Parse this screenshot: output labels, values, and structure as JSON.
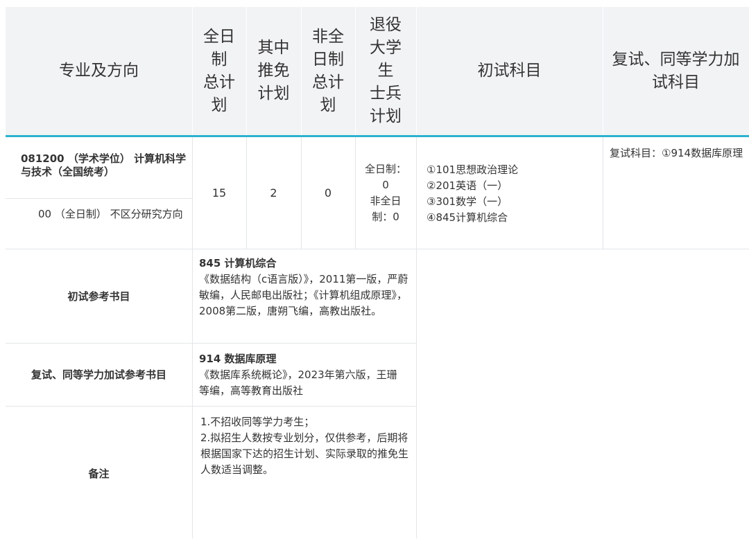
{
  "header": {
    "major": "专业及方向",
    "fulltime_plan": [
      "全日",
      "制",
      "总计",
      "划"
    ],
    "exempt_plan": [
      "其中",
      "推免",
      "计划"
    ],
    "parttime_plan": [
      "非全",
      "日制",
      "总计",
      "划"
    ],
    "veteran_plan": [
      "退役",
      "大学",
      "生",
      "士兵",
      "计划"
    ],
    "initial_subjects": "初试科目",
    "retest_subjects": [
      "复试、同等学力加",
      "试科目"
    ]
  },
  "major": {
    "name": "081200 （学术学位） 计算机科学与技术（全国统考）",
    "direction": "00 （全日制） 不区分研究方向",
    "fulltime_total": "15",
    "exempt": "2",
    "parttime_total": "0",
    "veteran": [
      "全日制：",
      "0",
      "非全日",
      "制：0"
    ],
    "initial_subjects": [
      "①101思想政治理论",
      "②201英语（一）",
      "③301数学（一）",
      "④845计算机综合"
    ],
    "retest_subjects": "复试科目：①914数据库原理"
  },
  "initial_books": {
    "label": "初试参考书目",
    "title": "845 计算机综合",
    "content": "《数据结构（c语言版）》，2011第一版，严蔚敏编，人民邮电出版社；《计算机组成原理》，2008第二版，唐朔飞编，高教出版社。"
  },
  "retest_books": {
    "label": "复试、同等学力加试参考书目",
    "title": "914 数据库原理",
    "content": "《数据库系统概论》，2023年第六版，王珊 等编，高等教育出版社"
  },
  "remarks": {
    "label": "备注",
    "lines": [
      "1.不招收同等学力考生；",
      "2.拟招生人数按专业划分，仅供参考，后期将根据国家下达的招生计划、实际录取的推免生人数适当调整。"
    ]
  }
}
